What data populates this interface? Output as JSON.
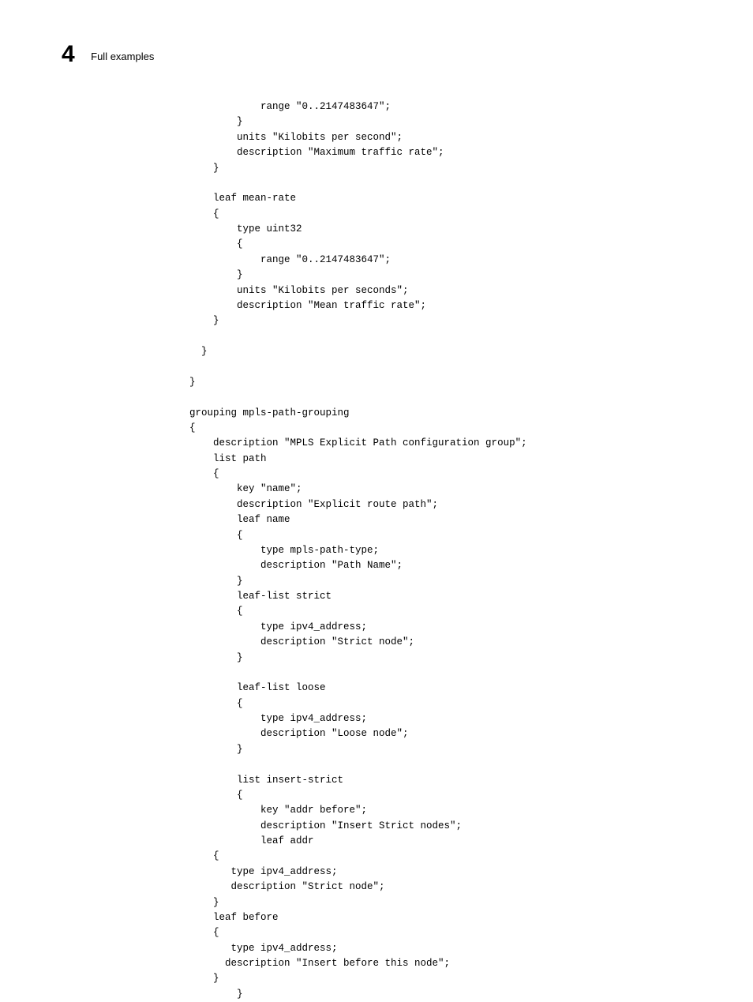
{
  "header": {
    "chapter_number": "4",
    "chapter_title": "Full examples"
  },
  "code": "            range \"0..2147483647\";\n        }\n        units \"Kilobits per second\";\n        description \"Maximum traffic rate\";\n    }\n\n    leaf mean-rate\n    {\n        type uint32\n        {\n            range \"0..2147483647\";\n        }\n        units \"Kilobits per seconds\";\n        description \"Mean traffic rate\";\n    }\n\n  }\n\n}\n\ngrouping mpls-path-grouping\n{\n    description \"MPLS Explicit Path configuration group\";\n    list path\n    {\n        key \"name\";\n        description \"Explicit route path\";\n        leaf name\n        {\n            type mpls-path-type;\n            description \"Path Name\";\n        }\n        leaf-list strict\n        {\n            type ipv4_address;\n            description \"Strict node\";\n        }\n\n        leaf-list loose\n        {\n            type ipv4_address;\n            description \"Loose node\";\n        }\n\n        list insert-strict\n        {\n            key \"addr before\";\n            description \"Insert Strict nodes\";\n            leaf addr\n    {\n       type ipv4_address;\n       description \"Strict node\";\n    }\n    leaf before\n    {\n       type ipv4_address;\n      description \"Insert before this node\";\n    }\n        }"
}
